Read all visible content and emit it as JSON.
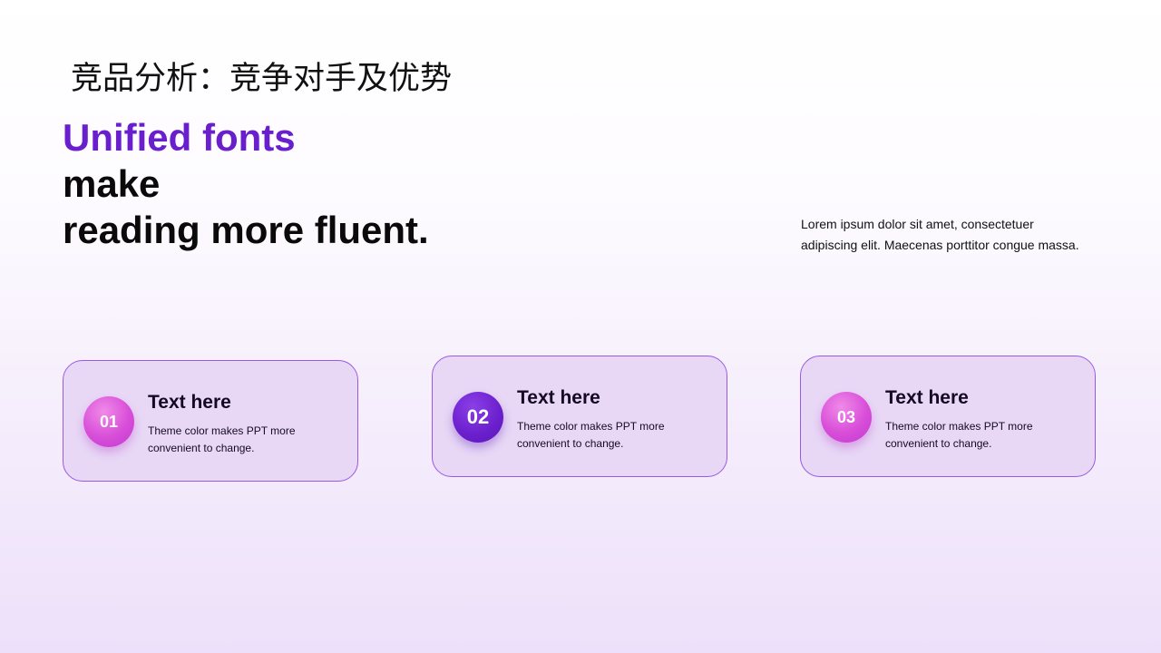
{
  "slide": {
    "title": "竞品分析：竞争对手及优势",
    "headline": {
      "line1": "Unified fonts",
      "line2": "make",
      "line3": "reading more fluent."
    },
    "description": {
      "line1": "Lorem ipsum dolor sit amet, consectetuer",
      "line2": "adipiscing elit. Maecenas porttitor congue massa."
    },
    "cards": [
      {
        "number": "01",
        "title": "Text here",
        "body_line1": "Theme color makes PPT more",
        "body_line2": "convenient to change."
      },
      {
        "number": "02",
        "title": "Text here",
        "body_line1": "Theme color makes PPT more",
        "body_line2": "convenient to change."
      },
      {
        "number": "03",
        "title": "Text here",
        "body_line1": "Theme color makes PPT more",
        "body_line2": "convenient to change."
      }
    ]
  },
  "colors": {
    "accent": "#6a1fcc",
    "badge_pink": "#d84ed8",
    "card_fill": "#e8d8f6",
    "card_border": "#9a5ae0"
  }
}
